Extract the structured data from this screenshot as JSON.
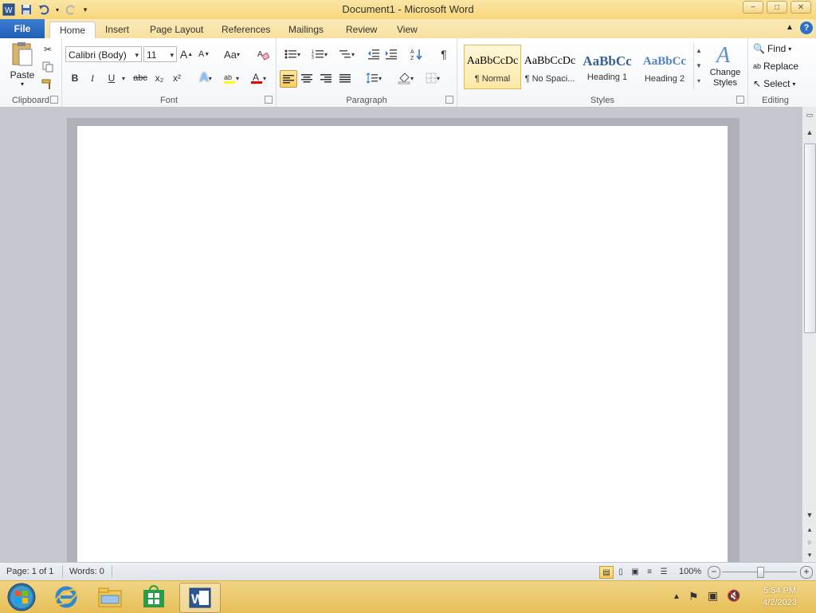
{
  "window": {
    "title": "Document1  -  Microsoft Word",
    "min_label": "−",
    "max_label": "□",
    "close_label": "✕"
  },
  "tabs": [
    {
      "label": "File"
    },
    {
      "label": "Home"
    },
    {
      "label": "Insert"
    },
    {
      "label": "Page Layout"
    },
    {
      "label": "References"
    },
    {
      "label": "Mailings"
    },
    {
      "label": "Review"
    },
    {
      "label": "View"
    }
  ],
  "ribbon": {
    "clipboard": {
      "label": "Clipboard",
      "paste_label": "Paste"
    },
    "font": {
      "label": "Font",
      "font_name": "Calibri (Body)",
      "font_size": "11",
      "bold": "B",
      "italic": "I",
      "underline": "U",
      "strike": "abc",
      "subscript": "x₂",
      "superscript": "x²",
      "grow": "A",
      "shrink": "A",
      "case": "Aa"
    },
    "paragraph": {
      "label": "Paragraph",
      "pilcrow": "¶"
    },
    "styles": {
      "label": "Styles",
      "items": [
        {
          "sample": "AaBbCcDc",
          "name": "¶ Normal"
        },
        {
          "sample": "AaBbCcDc",
          "name": "¶ No Spaci..."
        },
        {
          "sample": "AaBbCc",
          "name": "Heading 1"
        },
        {
          "sample": "AaBbCc",
          "name": "Heading 2"
        }
      ],
      "change_styles": "Change Styles"
    },
    "editing": {
      "label": "Editing",
      "find": "Find",
      "replace": "Replace",
      "select": "Select"
    }
  },
  "status": {
    "page": "Page: 1 of 1",
    "words": "Words: 0",
    "zoom": "100%"
  },
  "taskbar": {
    "time": "5:54 PM",
    "date": "4/2/2023"
  },
  "colors": {
    "file_tab": "#2a67c0",
    "highlight": "#ffff00",
    "font_color": "#e00000"
  }
}
